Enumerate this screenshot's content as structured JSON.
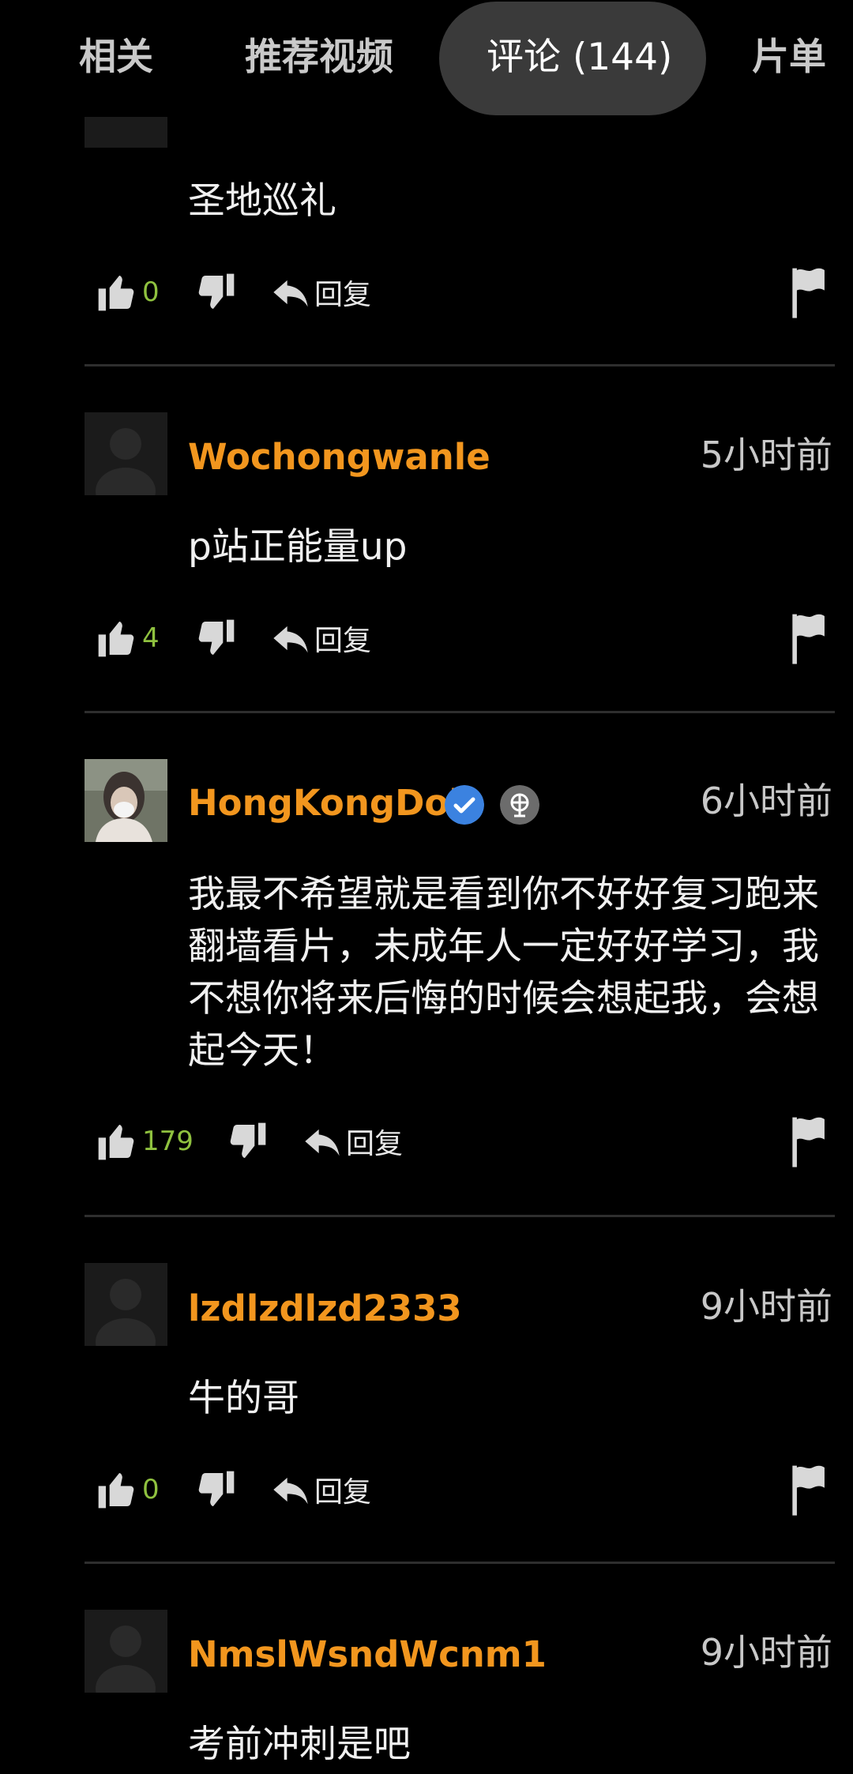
{
  "tabs": [
    {
      "label": "相关"
    },
    {
      "label": "推荐视频"
    },
    {
      "label": "评论 (144)"
    },
    {
      "label": "片单"
    }
  ],
  "colors": {
    "username": "#f2961e",
    "likes": "#8fc13f",
    "verified": "#3b82e0"
  },
  "reply_label": "回复",
  "comments": [
    {
      "user": "",
      "time": "",
      "text": "圣地巡礼",
      "likes": "0"
    },
    {
      "user": "Wochongwanle",
      "time": "5小时前",
      "text": "p站正能量up",
      "likes": "4"
    },
    {
      "user": "HongKongDoll",
      "time": "6小时前",
      "verified": true,
      "globe_badge": true,
      "text": "我最不希望就是看到你不好好复习跑来翻墙看片，未成年人一定好好学习，我不想你将来后悔的时候会想起我，会想起今天！",
      "likes": "179"
    },
    {
      "user": "lzdlzdlzd2333",
      "time": "9小时前",
      "text": "牛的哥",
      "likes": "0"
    },
    {
      "user": "NmslWsndWcnm1",
      "time": "9小时前",
      "text": "考前冲刺是吧",
      "likes": ""
    }
  ]
}
